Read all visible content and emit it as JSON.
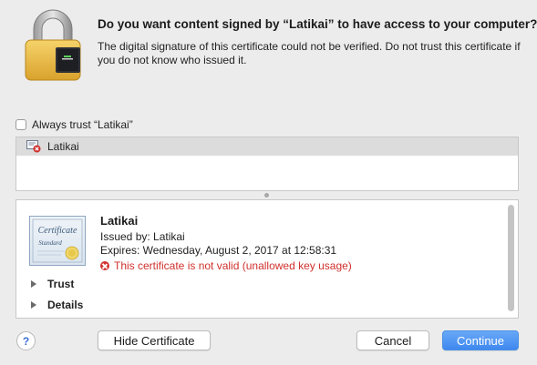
{
  "dialog": {
    "title": "Do you want content signed by “Latikai” to have access to your computer?",
    "message": "The digital signature of this certificate could not be verified. Do not trust this certificate if you do not know who issued it.",
    "always_trust_label": "Always trust “Latikai”",
    "always_trust_checked": false
  },
  "certificate_list": {
    "items": [
      {
        "label": "Latikai",
        "icon": "certificate-error-icon",
        "selected": true
      }
    ]
  },
  "certificate_detail": {
    "image_text_line1": "Certificate",
    "image_text_line2": "Standard",
    "name": "Latikai",
    "issued_by": "Issued by: Latikai",
    "expires": "Expires: Wednesday, August 2, 2017 at 12:58:31",
    "status": "This certificate is not valid (unallowed key usage)",
    "sections": [
      {
        "label": "Trust"
      },
      {
        "label": "Details"
      }
    ]
  },
  "buttons": {
    "help": "?",
    "hide_certificate": "Hide Certificate",
    "cancel": "Cancel",
    "continue": "Continue"
  },
  "colors": {
    "error": "#d0312d",
    "accent": "#3e88ef",
    "background": "#ececec"
  }
}
